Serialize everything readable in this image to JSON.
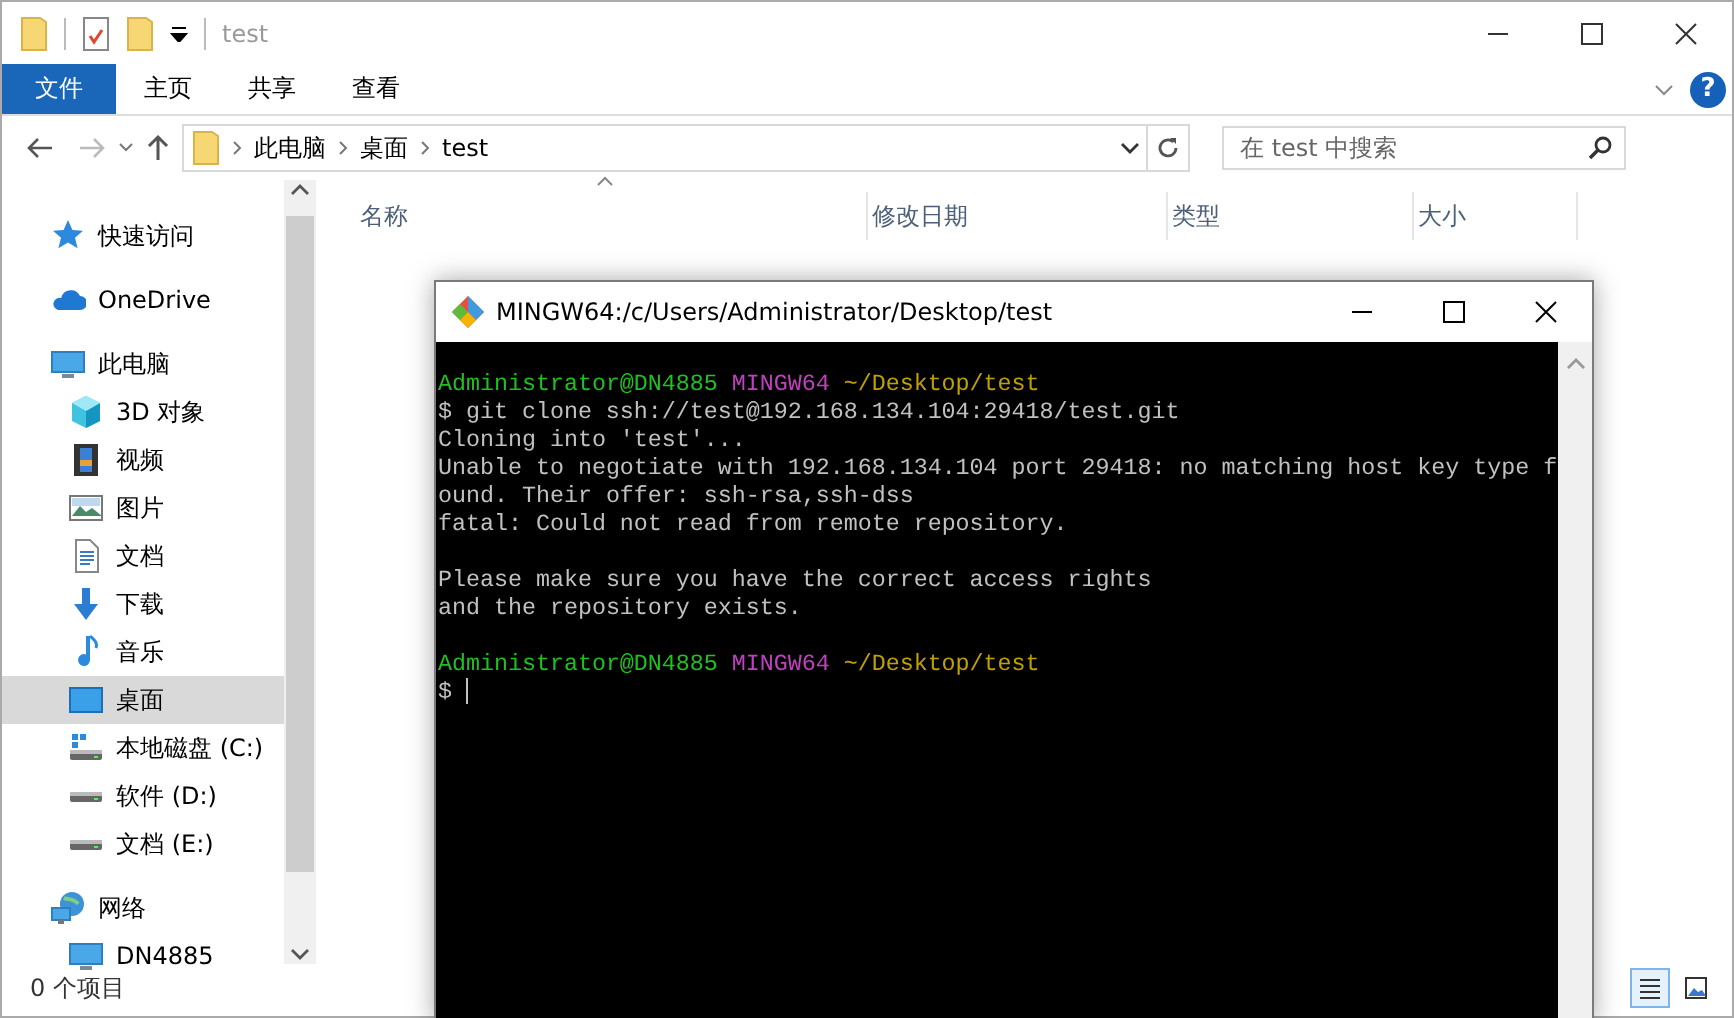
{
  "window": {
    "title": "test"
  },
  "ribbon": {
    "tabs": [
      {
        "label": "文件",
        "selected": true
      },
      {
        "label": "主页",
        "selected": false
      },
      {
        "label": "共享",
        "selected": false
      },
      {
        "label": "查看",
        "selected": false
      }
    ],
    "help": "?"
  },
  "address_bar": {
    "crumbs": [
      "此电脑",
      "桌面",
      "test"
    ]
  },
  "search": {
    "placeholder": "在 test 中搜索"
  },
  "columns": [
    {
      "label": "名称",
      "sorted": true
    },
    {
      "label": "修改日期",
      "sorted": false
    },
    {
      "label": "类型",
      "sorted": false
    },
    {
      "label": "大小",
      "sorted": false
    }
  ],
  "sidebar": {
    "items": [
      {
        "label": "快速访问",
        "kind": "star",
        "selected": false
      },
      {
        "label": "OneDrive",
        "kind": "cloud",
        "selected": false
      },
      {
        "label": "此电脑",
        "kind": "pc",
        "selected": false,
        "children": [
          {
            "label": "3D 对象",
            "kind": "cube",
            "selected": false
          },
          {
            "label": "视频",
            "kind": "film",
            "selected": false
          },
          {
            "label": "图片",
            "kind": "picture",
            "selected": false
          },
          {
            "label": "文档",
            "kind": "document",
            "selected": false
          },
          {
            "label": "下载",
            "kind": "download",
            "selected": false
          },
          {
            "label": "音乐",
            "kind": "music",
            "selected": false
          },
          {
            "label": "桌面",
            "kind": "desktop",
            "selected": true
          },
          {
            "label": "本地磁盘 (C:)",
            "kind": "system_drive",
            "selected": false
          },
          {
            "label": "软件 (D:)",
            "kind": "drive",
            "selected": false
          },
          {
            "label": "文档 (E:)",
            "kind": "drive",
            "selected": false
          }
        ]
      },
      {
        "label": "网络",
        "kind": "network",
        "selected": false,
        "children": [
          {
            "label": "DN4885",
            "kind": "pc",
            "selected": false
          }
        ]
      }
    ]
  },
  "status_bar": {
    "count": "0 个项目",
    "views": [
      {
        "kind": "details",
        "selected": true
      },
      {
        "kind": "large_icons",
        "selected": false
      }
    ]
  },
  "terminal": {
    "title": "MINGW64:/c/Users/Administrator/Desktop/test",
    "lines": [
      {
        "kind": "prompt",
        "user": "Administrator@DN4885",
        "shell": "MINGW64",
        "path": "~/Desktop/test"
      },
      {
        "kind": "command",
        "prompt": "$",
        "text": "git clone ssh://test@192.168.134.104:29418/test.git"
      },
      {
        "kind": "output",
        "text": "Cloning into 'test'..."
      },
      {
        "kind": "output",
        "text": "Unable to negotiate with 192.168.134.104 port 29418: no matching host key type f"
      },
      {
        "kind": "output",
        "text": "ound. Their offer: ssh-rsa,ssh-dss"
      },
      {
        "kind": "output",
        "text": "fatal: Could not read from remote repository."
      },
      {
        "kind": "blank"
      },
      {
        "kind": "output",
        "text": "Please make sure you have the correct access rights"
      },
      {
        "kind": "output",
        "text": "and the repository exists."
      },
      {
        "kind": "blank"
      },
      {
        "kind": "prompt",
        "user": "Administrator@DN4885",
        "shell": "MINGW64",
        "path": "~/Desktop/test"
      },
      {
        "kind": "input",
        "prompt": "$",
        "cursor": true
      }
    ]
  }
}
